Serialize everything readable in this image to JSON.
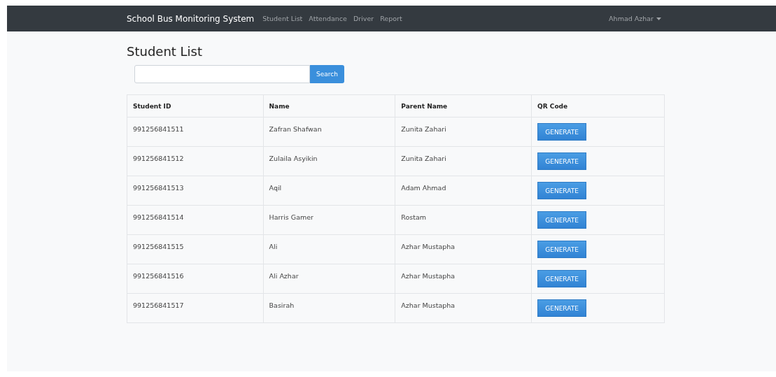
{
  "navbar": {
    "brand": "School Bus Monitoring System",
    "links": [
      {
        "label": "Student List"
      },
      {
        "label": "Attendance"
      },
      {
        "label": "Driver"
      },
      {
        "label": "Report"
      }
    ],
    "user": "Ahmad Azhar"
  },
  "title": "Student List",
  "search": {
    "button": "Search"
  },
  "table": {
    "columns": [
      "Student ID",
      "Name",
      "Parent Name",
      "QR Code"
    ],
    "rows": [
      {
        "student_id": "991256841511",
        "name": "Zafran Shafwan",
        "parent_name": "Zunita Zahari",
        "action": "GENERATE"
      },
      {
        "student_id": "991256841512",
        "name": "Zulaila Asyikin",
        "parent_name": "Zunita Zahari",
        "action": "GENERATE"
      },
      {
        "student_id": "991256841513",
        "name": "Aqil",
        "parent_name": "Adam Ahmad",
        "action": "GENERATE"
      },
      {
        "student_id": "991256841514",
        "name": "Harris Gamer",
        "parent_name": "Rostam",
        "action": "GENERATE"
      },
      {
        "student_id": "991256841515",
        "name": "Ali",
        "parent_name": "Azhar Mustapha",
        "action": "GENERATE"
      },
      {
        "student_id": "991256841516",
        "name": "Ali Azhar",
        "parent_name": "Azhar Mustapha",
        "action": "GENERATE"
      },
      {
        "student_id": "991256841517",
        "name": "Basirah",
        "parent_name": "Azhar Mustapha",
        "action": "GENERATE"
      }
    ]
  }
}
